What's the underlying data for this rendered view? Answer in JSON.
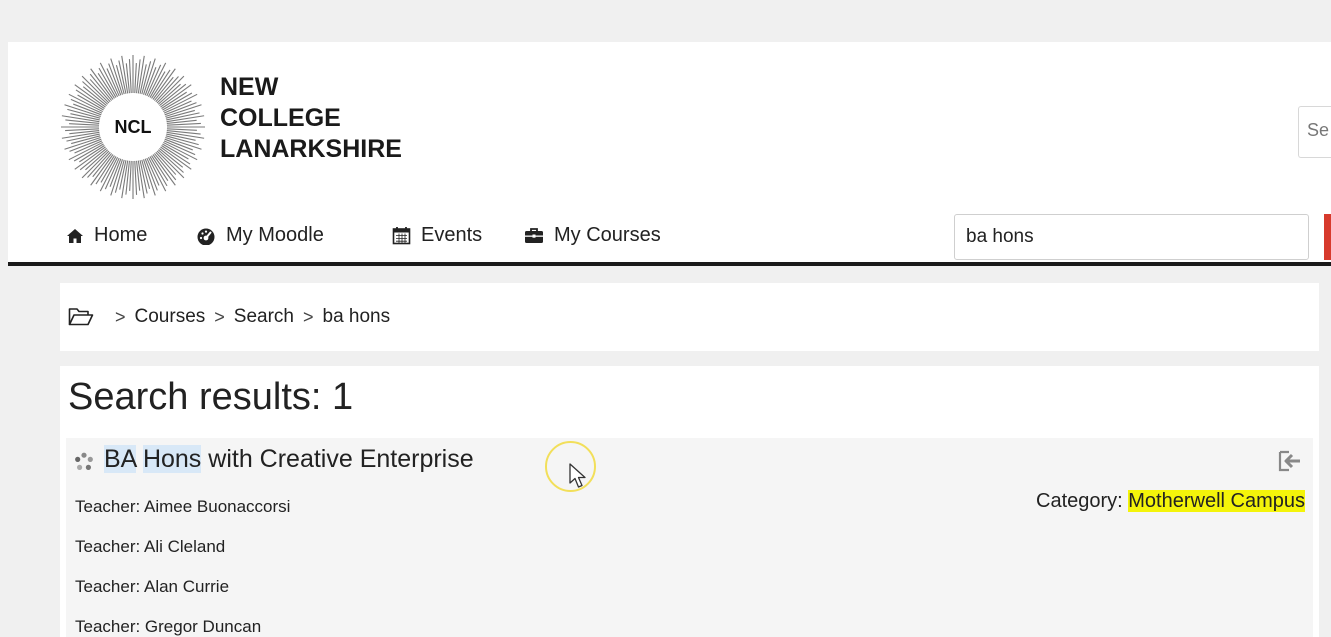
{
  "brand": {
    "logo_text": "NCL",
    "name_lines": [
      "NEW",
      "COLLEGE",
      "LANARKSHIRE"
    ]
  },
  "top_search": {
    "value": "Se"
  },
  "nav": {
    "items": [
      {
        "label": "Home",
        "icon": "home-icon"
      },
      {
        "label": "My Moodle",
        "icon": "dashboard-icon"
      },
      {
        "label": "Events",
        "icon": "calendar-icon"
      },
      {
        "label": "My Courses",
        "icon": "briefcase-icon"
      }
    ],
    "search_value": "ba hons"
  },
  "breadcrumb": {
    "icon": "folder-open-icon",
    "separator": ">",
    "items": [
      "Courses",
      "Search",
      "ba hons"
    ]
  },
  "results": {
    "title": "Search results: 1",
    "course": {
      "name_hl_1": "BA",
      "name_space": " ",
      "name_hl_2": "Hons",
      "name_rest": " with Creative Enterprise",
      "teachers": [
        "Teacher: Aimee Buonaccorsi",
        "Teacher: Ali Cleland",
        "Teacher: Alan Currie",
        "Teacher: Gregor Duncan"
      ],
      "category_label": "Category: ",
      "category_value": "Motherwell Campus"
    }
  },
  "colors": {
    "accent_red": "#d73a2c",
    "search_highlight": "#d8e8f7",
    "category_highlight": "#f4f40a",
    "cursor_ring": "#f2df5a"
  }
}
